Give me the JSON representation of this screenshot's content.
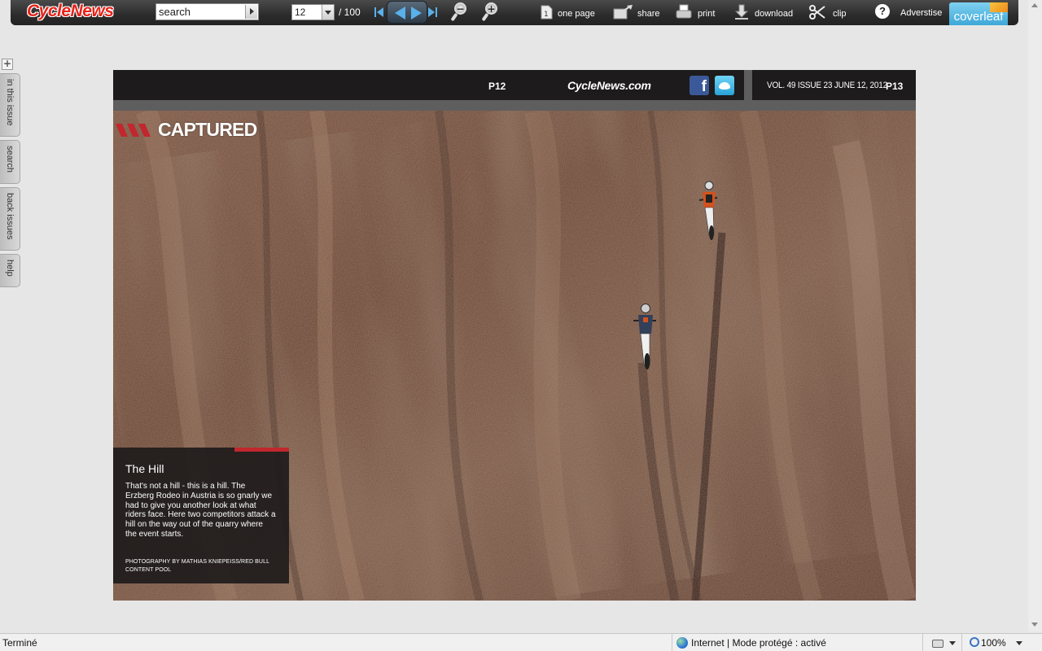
{
  "toolbar": {
    "logo": "CycleNews",
    "search_value": "search",
    "page_current": "12",
    "page_total": "/ 100",
    "tools": {
      "one_page": "one page",
      "share": "share",
      "print": "print",
      "download": "download",
      "clip": "clip"
    },
    "help": "?",
    "advertise": "Adverstise",
    "brand": "coverleaf"
  },
  "side_tabs": [
    "in this issue",
    "search",
    "back issues",
    "help"
  ],
  "spread": {
    "page_left": "P12",
    "site": "CycleNews.com",
    "issue_info": "VOL. 49  ISSUE 23   JUNE 12, 2012",
    "page_right": "P13",
    "section": "CAPTURED",
    "caption_title": "The Hill",
    "caption_body": "That's not a hill - this is a hill. The Erzberg Rodeo in Austria is so gnarly we had to give you another look at what riders face. Here two competitors attack a hill on the way out of the quarry where the event starts.",
    "credit": "PHOTOGRAPHY BY MATHIAS KNIEPEISS/RED BULL CONTENT POOL"
  },
  "statusbar": {
    "status": "Terminé",
    "zone": "Internet | Mode protégé : activé",
    "zoom": "100%"
  },
  "colors": {
    "brand_red": "#e8231a",
    "accent_red": "#c1272d",
    "nav_blue": "#5ab0e8",
    "header_black": "#1d1b1b"
  }
}
